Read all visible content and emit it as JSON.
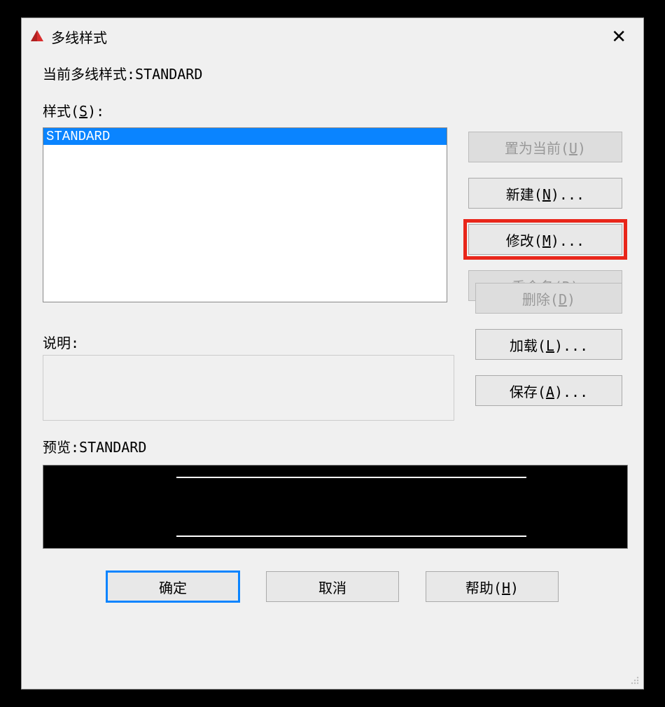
{
  "titlebar": {
    "title": "多线样式",
    "close": "✕"
  },
  "current_style_label": "当前多线样式:",
  "current_style_value": "STANDARD",
  "styles_label": "样式(S):",
  "styles_list": [
    "STANDARD"
  ],
  "buttons": {
    "set_current": "置为当前(U)",
    "new": "新建(N)...",
    "modify": "修改(M)...",
    "rename": "重命名(R)",
    "delete": "删除(D)",
    "load": "加载(L)...",
    "save": "保存(A)..."
  },
  "description_label": "说明:",
  "preview_label_prefix": "预览:",
  "preview_label_value": "STANDARD",
  "bottom": {
    "ok": "确定",
    "cancel": "取消",
    "help": "帮助(H)"
  }
}
